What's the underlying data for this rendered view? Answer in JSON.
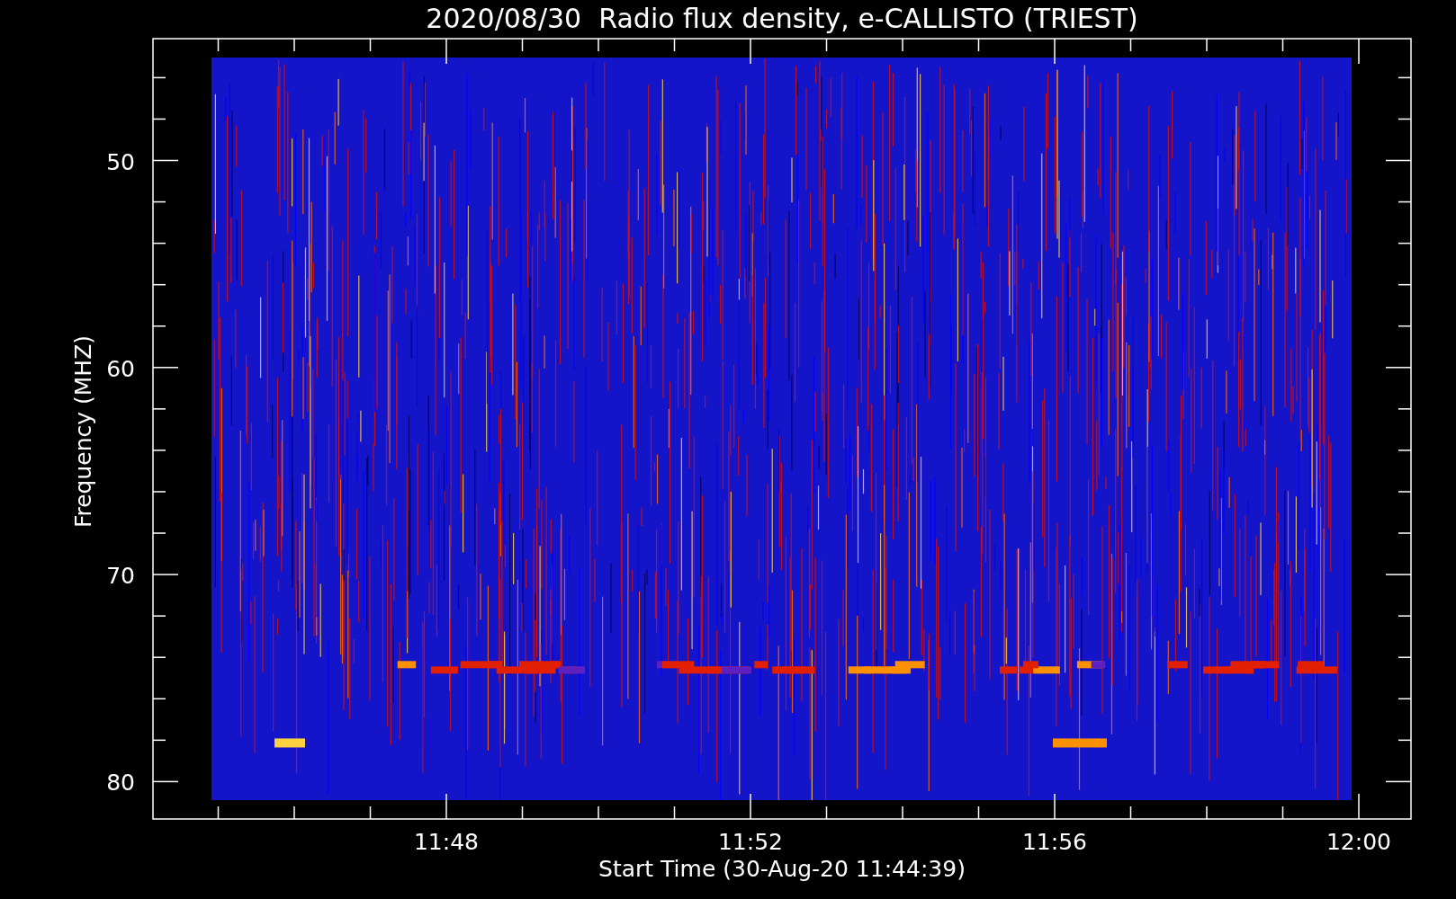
{
  "title": "2020/08/30  Radio flux density, e-CALLISTO (TRIEST)",
  "y_axis": {
    "label": "Frequency (MHZ)",
    "ticks": [
      "50",
      "60",
      "70",
      "80"
    ]
  },
  "x_axis": {
    "label": "Start Time (30-Aug-20 11:44:39)",
    "ticks": [
      "11:48",
      "11:52",
      "11:56",
      "12:00"
    ]
  }
}
